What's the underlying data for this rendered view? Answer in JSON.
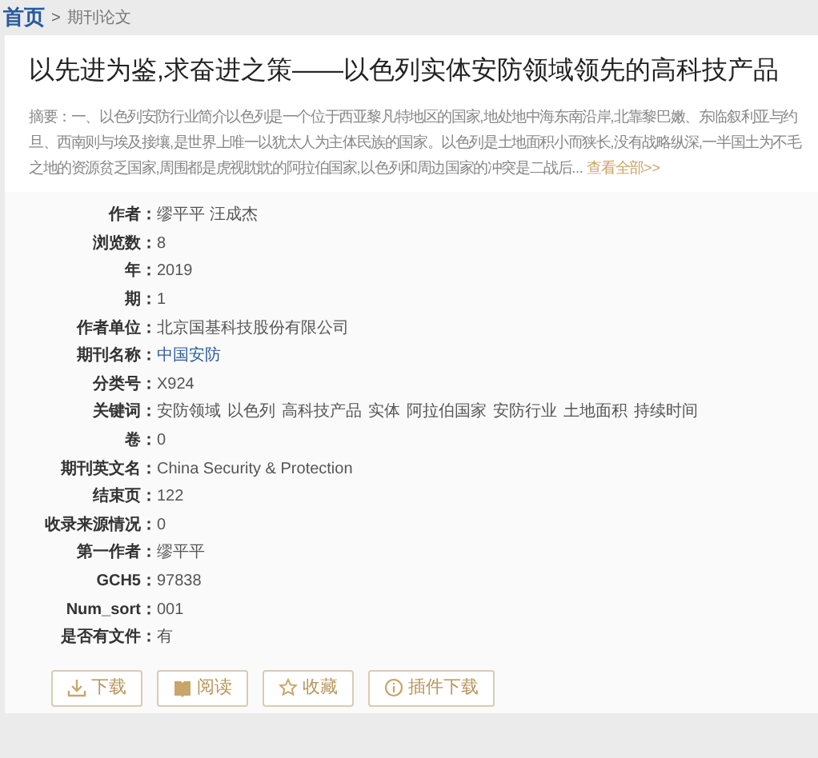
{
  "breadcrumb": {
    "home": "首页",
    "separator": ">",
    "current": "期刊论文"
  },
  "title": "以先进为鉴,求奋进之策——以色列实体安防领域领先的高科技产品",
  "abstract": {
    "label": "摘要：",
    "text": "一、以色列安防行业简介以色列是一个位于西亚黎凡特地区的国家,地处地中海东南沿岸,北靠黎巴嫩、东临叙利亚与约旦、西南则与埃及接壤,是世界上唯一以犹太人为主体民族的国家。以色列是土地面积小而狭长,没有战略纵深,一半国土为不毛之地的资源贫乏国家,周围都是虎视眈眈的阿拉伯国家,以色列和周边国家的冲突是二战后...",
    "more": "查看全部>>"
  },
  "fields": [
    {
      "label": "作者",
      "value": "缪平平 汪成杰",
      "kind": "text"
    },
    {
      "label": "浏览数",
      "value": "8",
      "kind": "text"
    },
    {
      "label": "年",
      "value": "2019",
      "kind": "text"
    },
    {
      "label": "期",
      "value": "1",
      "kind": "text"
    },
    {
      "label": "作者单位",
      "value": "北京国基科技股份有限公司",
      "kind": "text"
    },
    {
      "label": "期刊名称",
      "value": "中国安防",
      "kind": "link"
    },
    {
      "label": "分类号",
      "value": "X924",
      "kind": "text"
    },
    {
      "label": "关键词",
      "kind": "keywords",
      "keywords": [
        "安防领域",
        "以色列",
        "高科技产品",
        "实体",
        "阿拉伯国家",
        "安防行业",
        "土地面积",
        "持续时间"
      ]
    },
    {
      "label": "卷",
      "value": "0",
      "kind": "text"
    },
    {
      "label": "期刊英文名",
      "value": "China Security & Protection",
      "kind": "text"
    },
    {
      "label": "结束页",
      "value": "122",
      "kind": "text"
    },
    {
      "label": "收录来源情况",
      "value": "0",
      "kind": "text"
    },
    {
      "label": "第一作者",
      "value": "缪平平",
      "kind": "text"
    },
    {
      "label": "GCH5",
      "value": "97838",
      "kind": "text"
    },
    {
      "label": "Num_sort",
      "value": "001",
      "kind": "text"
    },
    {
      "label": "是否有文件",
      "value": "有",
      "kind": "text"
    }
  ],
  "label_suffix": "：",
  "actions": [
    {
      "label": "下载"
    },
    {
      "label": "阅读"
    },
    {
      "label": "收藏"
    },
    {
      "label": "插件下载"
    }
  ]
}
